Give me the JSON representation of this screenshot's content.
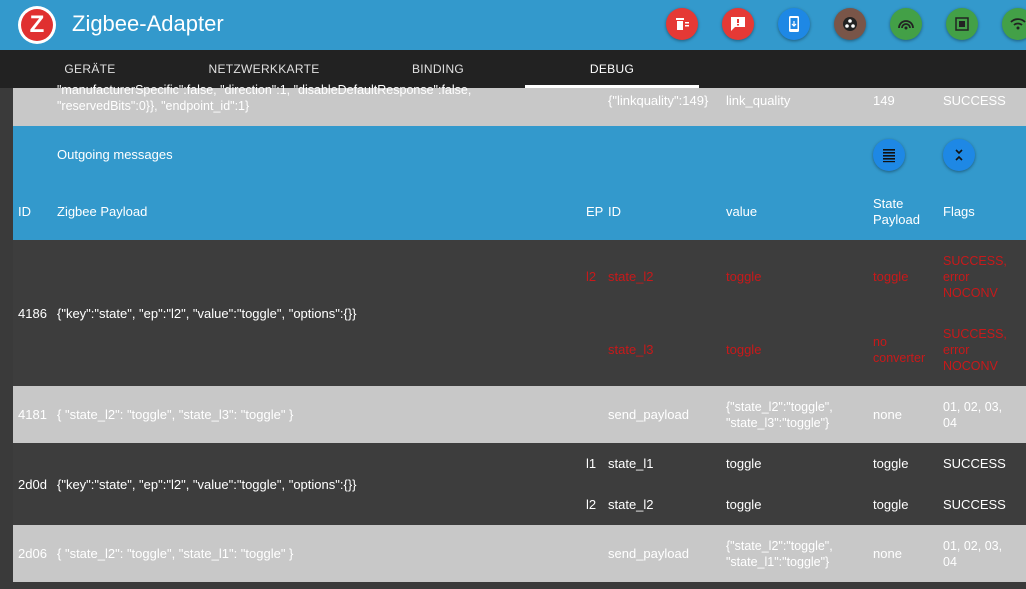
{
  "app": {
    "title": "Zigbee-Adapter",
    "logo_letter": "Z"
  },
  "toolbar_buttons": [
    {
      "name": "delete-icon",
      "color": "#e53935"
    },
    {
      "name": "message-icon",
      "color": "#e53935"
    },
    {
      "name": "phone-icon",
      "color": "#1e88e5"
    },
    {
      "name": "network-icon",
      "color": "#795548"
    },
    {
      "name": "signal-icon",
      "color": "#43a047"
    },
    {
      "name": "chip-icon",
      "color": "#43a047"
    },
    {
      "name": "wifi-icon",
      "color": "#43a047"
    }
  ],
  "tabs": [
    {
      "label": "GERÄTE"
    },
    {
      "label": "NETZWERKKARTE"
    },
    {
      "label": "BINDING"
    },
    {
      "label": "DEBUG",
      "active": true
    }
  ],
  "prev_row": {
    "payload_line1": "\"manufacturerSpecific\":false, \"direction\":1, \"disableDefaultResponse\":false,",
    "payload_line2": "\"reservedBits\":0}}, \"endpoint_id\":1}",
    "state_payload": "{\"linkquality\":149}",
    "id": "link_quality",
    "value": "149",
    "flags": "SUCCESS"
  },
  "section": {
    "title": "Outgoing messages",
    "columns": {
      "id": "ID",
      "zigbee_payload": "Zigbee Payload",
      "ep": "EP",
      "state_id": "ID",
      "value": "value",
      "state_payload_1": "State",
      "state_payload_2": "Payload",
      "flags": "Flags"
    }
  },
  "rows": [
    {
      "id": "4186",
      "payload": "{\"key\":\"state\", \"ep\":\"l2\", \"value\":\"toggle\", \"options\":{}}",
      "sub": [
        {
          "ep": "l2",
          "id": "state_l2",
          "value": "toggle",
          "payload": "toggle",
          "flags1": "SUCCESS,",
          "flags2": "error",
          "flags3": "NOCONV"
        },
        {
          "ep": "",
          "id": "state_l3",
          "value": "toggle",
          "payload1": "no",
          "payload2": "converter",
          "flags1": "SUCCESS,",
          "flags2": "error",
          "flags3": "NOCONV"
        }
      ]
    },
    {
      "id": "4181",
      "payload": "{ \"state_l2\": \"toggle\", \"state_l3\": \"toggle\" }",
      "sub_id": "send_payload",
      "value1": "{\"state_l2\":\"toggle\",",
      "value2": "\"state_l3\":\"toggle\"}",
      "state_payload": "none",
      "flags1": "01, 02, 03,",
      "flags2": "04"
    },
    {
      "id": "2d0d",
      "payload": "{\"key\":\"state\", \"ep\":\"l2\", \"value\":\"toggle\", \"options\":{}}",
      "sub": [
        {
          "ep": "l1",
          "id": "state_l1",
          "value": "toggle",
          "payload": "toggle",
          "flags": "SUCCESS"
        },
        {
          "ep": "l2",
          "id": "state_l2",
          "value": "toggle",
          "payload": "toggle",
          "flags": "SUCCESS"
        }
      ]
    },
    {
      "id": "2d06",
      "payload": "{ \"state_l2\": \"toggle\", \"state_l1\": \"toggle\" }",
      "sub_id": "send_payload",
      "value1": "{\"state_l2\":\"toggle\",",
      "value2": "\"state_l1\":\"toggle\"}",
      "state_payload": "none",
      "flags1": "01, 02, 03,",
      "flags2": "04"
    }
  ]
}
